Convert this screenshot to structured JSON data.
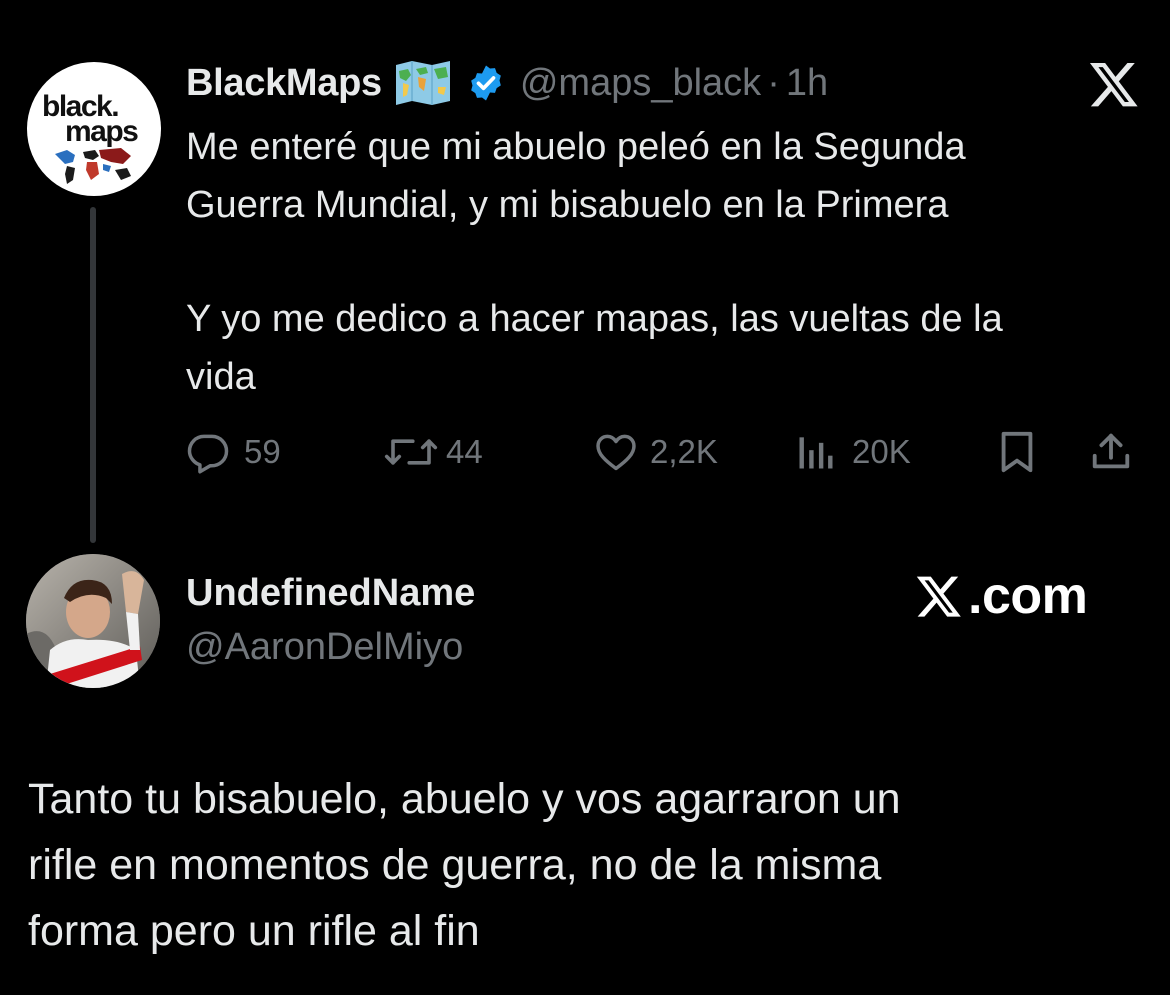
{
  "original_tweet": {
    "avatar": {
      "logo_line1": "black.",
      "logo_line2": "maps"
    },
    "display_name": "BlackMaps",
    "name_emoji": "world-map-emoji",
    "verified_icon": "verified-badge-icon",
    "handle": "@maps_black",
    "separator": "·",
    "time": "1h",
    "platform_icon": "x-logo-icon",
    "text_paragraph_1": "Me enteré que mi abuelo peleó en la Segunda\nGuerra Mundial, y mi bisabuelo en la Primera",
    "text_paragraph_2": "Y yo me dedico a hacer mapas, las vueltas de la\nvida",
    "actions": {
      "replies": "59",
      "reposts": "44",
      "likes": "2,2K",
      "views": "20K"
    }
  },
  "reply": {
    "display_name": "UndefinedName",
    "handle": "@AaronDelMiyo",
    "brand": "com",
    "brand_prefix_icon": "x-logo-icon",
    "text": "Tanto tu bisabuelo, abuelo y vos agarraron un\nrifle en momentos de guerra, no de la misma\nforma pero un rifle al fin"
  },
  "colors": {
    "background": "#000000",
    "primary_text": "#e7e9ea",
    "secondary_text": "#71767b",
    "verified_blue": "#1d9bf0"
  }
}
